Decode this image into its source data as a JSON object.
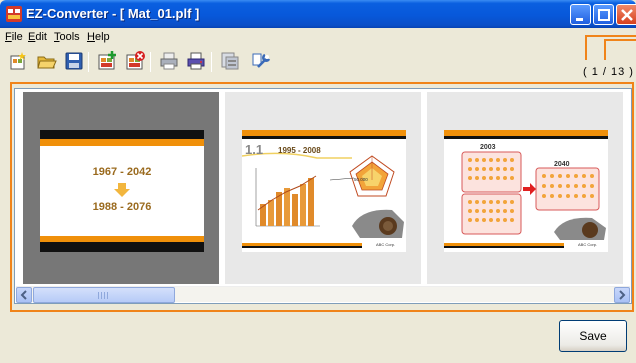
{
  "window": {
    "title": "EZ-Converter  - [ Mat_01.plf ]",
    "accent_color": "#0A5FE0",
    "highlight_color": "#F0841A"
  },
  "menubar": {
    "items": [
      {
        "accel": "F",
        "rest": "ile"
      },
      {
        "accel": "E",
        "rest": "dit"
      },
      {
        "accel": "T",
        "rest": "ools"
      },
      {
        "accel": "H",
        "rest": "elp"
      }
    ]
  },
  "toolbar": {
    "icons": [
      "new-icon",
      "open-folder-icon",
      "save-disk-icon",
      "add-slide-icon",
      "delete-slide-icon",
      "print-icon",
      "print-color-icon",
      "export-icon",
      "settings-wrench-icon"
    ],
    "page_counter": "( 1 / 13 )"
  },
  "slides": [
    {
      "selected": true,
      "line1": "1967 - 2042",
      "line2": "1988 - 2076"
    },
    {
      "selected": false,
      "heading_num": "1.1",
      "heading_range": "1995 - 2008",
      "label": "50,000",
      "footer": "ABC Corp."
    },
    {
      "selected": false,
      "left_label": "2003",
      "right_label": "2040",
      "footer": "ABC Corp."
    }
  ],
  "scrollbar": {
    "left_arrow": "<",
    "right_arrow": ">",
    "grip": "|||"
  },
  "footer": {
    "save_label": "Save"
  }
}
